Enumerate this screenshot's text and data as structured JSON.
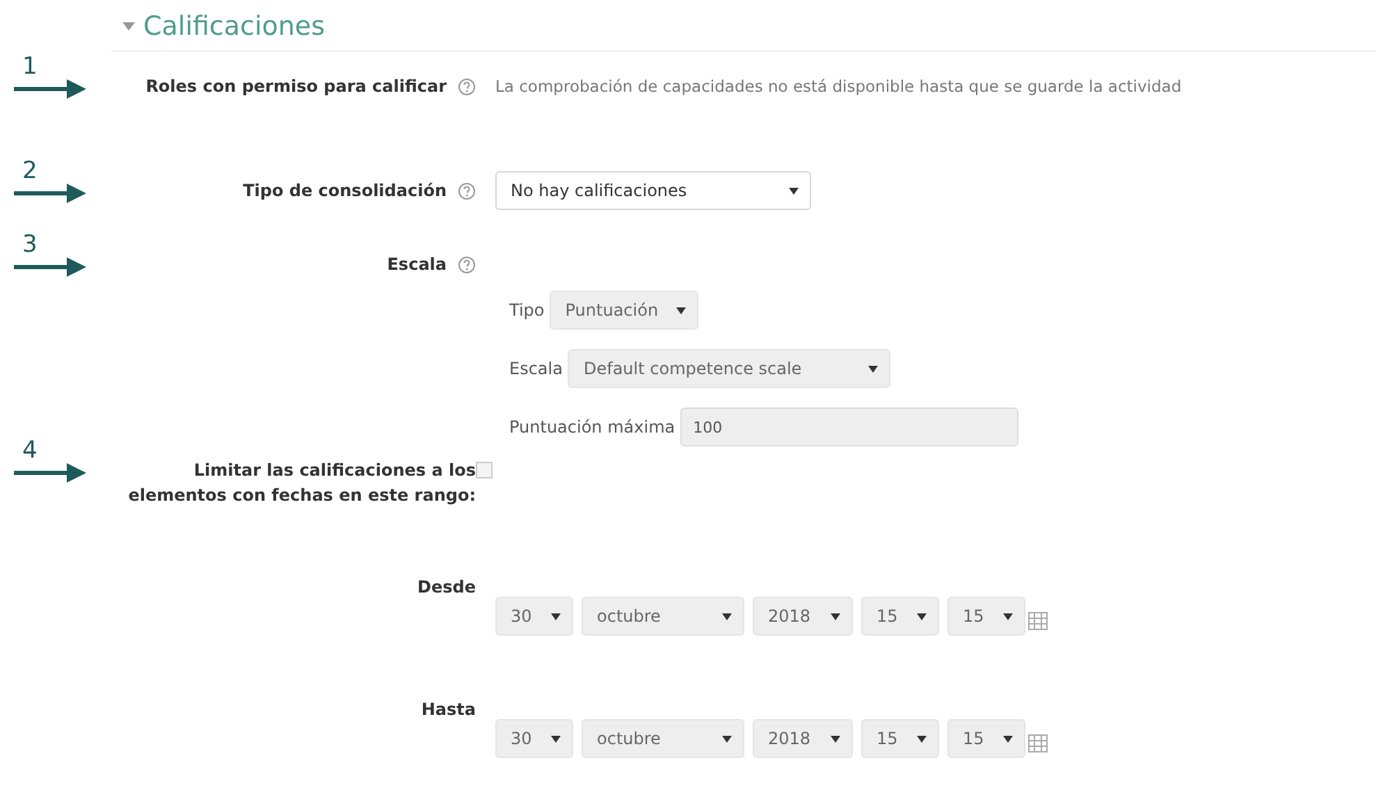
{
  "section": {
    "title": "Calificaciones",
    "expanded": true
  },
  "fields": [
    {
      "kind": "note",
      "marker": "1",
      "label": "Roles con permiso para calificar",
      "help": true,
      "text": "La comprobación de capacidades no está disponible hasta que se guarde la actividad"
    },
    {
      "kind": "select",
      "marker": "2",
      "label": "Tipo de consolidación",
      "help": true,
      "value": "No hay calificaciones",
      "disabled": false
    },
    {
      "kind": "group",
      "marker": "3",
      "label": "Escala",
      "help": true,
      "items": [
        {
          "kind": "select",
          "label": "Tipo",
          "value": "Puntuación",
          "disabled": true
        },
        {
          "kind": "select",
          "label": "Escala",
          "value": "Default competence scale",
          "disabled": true
        },
        {
          "kind": "input",
          "label": "Puntuación máxima",
          "value": "100",
          "disabled": true
        }
      ]
    },
    {
      "kind": "checkbox",
      "marker": "4",
      "label": "Limitar las calificaciones a los elementos con fechas en este rango:",
      "checked": false
    },
    {
      "kind": "date",
      "label": "Desde",
      "parts": [
        "30",
        "octubre",
        "2018",
        "15",
        "15"
      ],
      "disabled": true
    },
    {
      "kind": "date",
      "label": "Hasta",
      "parts": [
        "30",
        "octubre",
        "2018",
        "15",
        "15"
      ],
      "disabled": true
    }
  ]
}
